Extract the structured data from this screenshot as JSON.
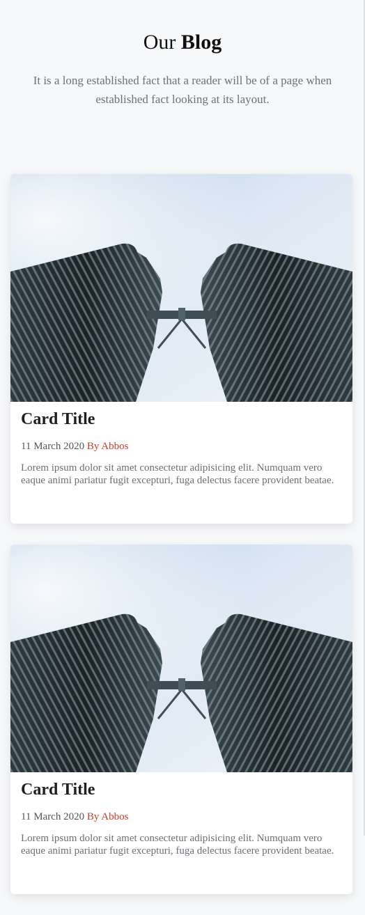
{
  "header": {
    "title_regular": "Our",
    "title_bold": "Blog",
    "subtitle": "It is a long established fact that a reader will be of a page when established fact looking at its layout."
  },
  "cards": [
    {
      "image_alt": "twin towers",
      "title": "Card Title",
      "date": "11 March 2020",
      "author": "By Abbos",
      "text": "Lorem ipsum dolor sit amet consectetur adipisicing elit. Numquam vero eaque animi pariatur fugit excepturi, fuga delectus facere provident beatae."
    },
    {
      "image_alt": "twin towers",
      "title": "Card Title",
      "date": "11 March 2020",
      "author": "By Abbos",
      "text": "Lorem ipsum dolor sit amet consectetur adipisicing elit. Numquam vero eaque animi pariatur fugit excepturi, fuga delectus facere provident beatae."
    }
  ],
  "colors": {
    "background": "#f7f8fa",
    "author_accent": "#d23a2a",
    "muted_text": "#6c7078"
  }
}
